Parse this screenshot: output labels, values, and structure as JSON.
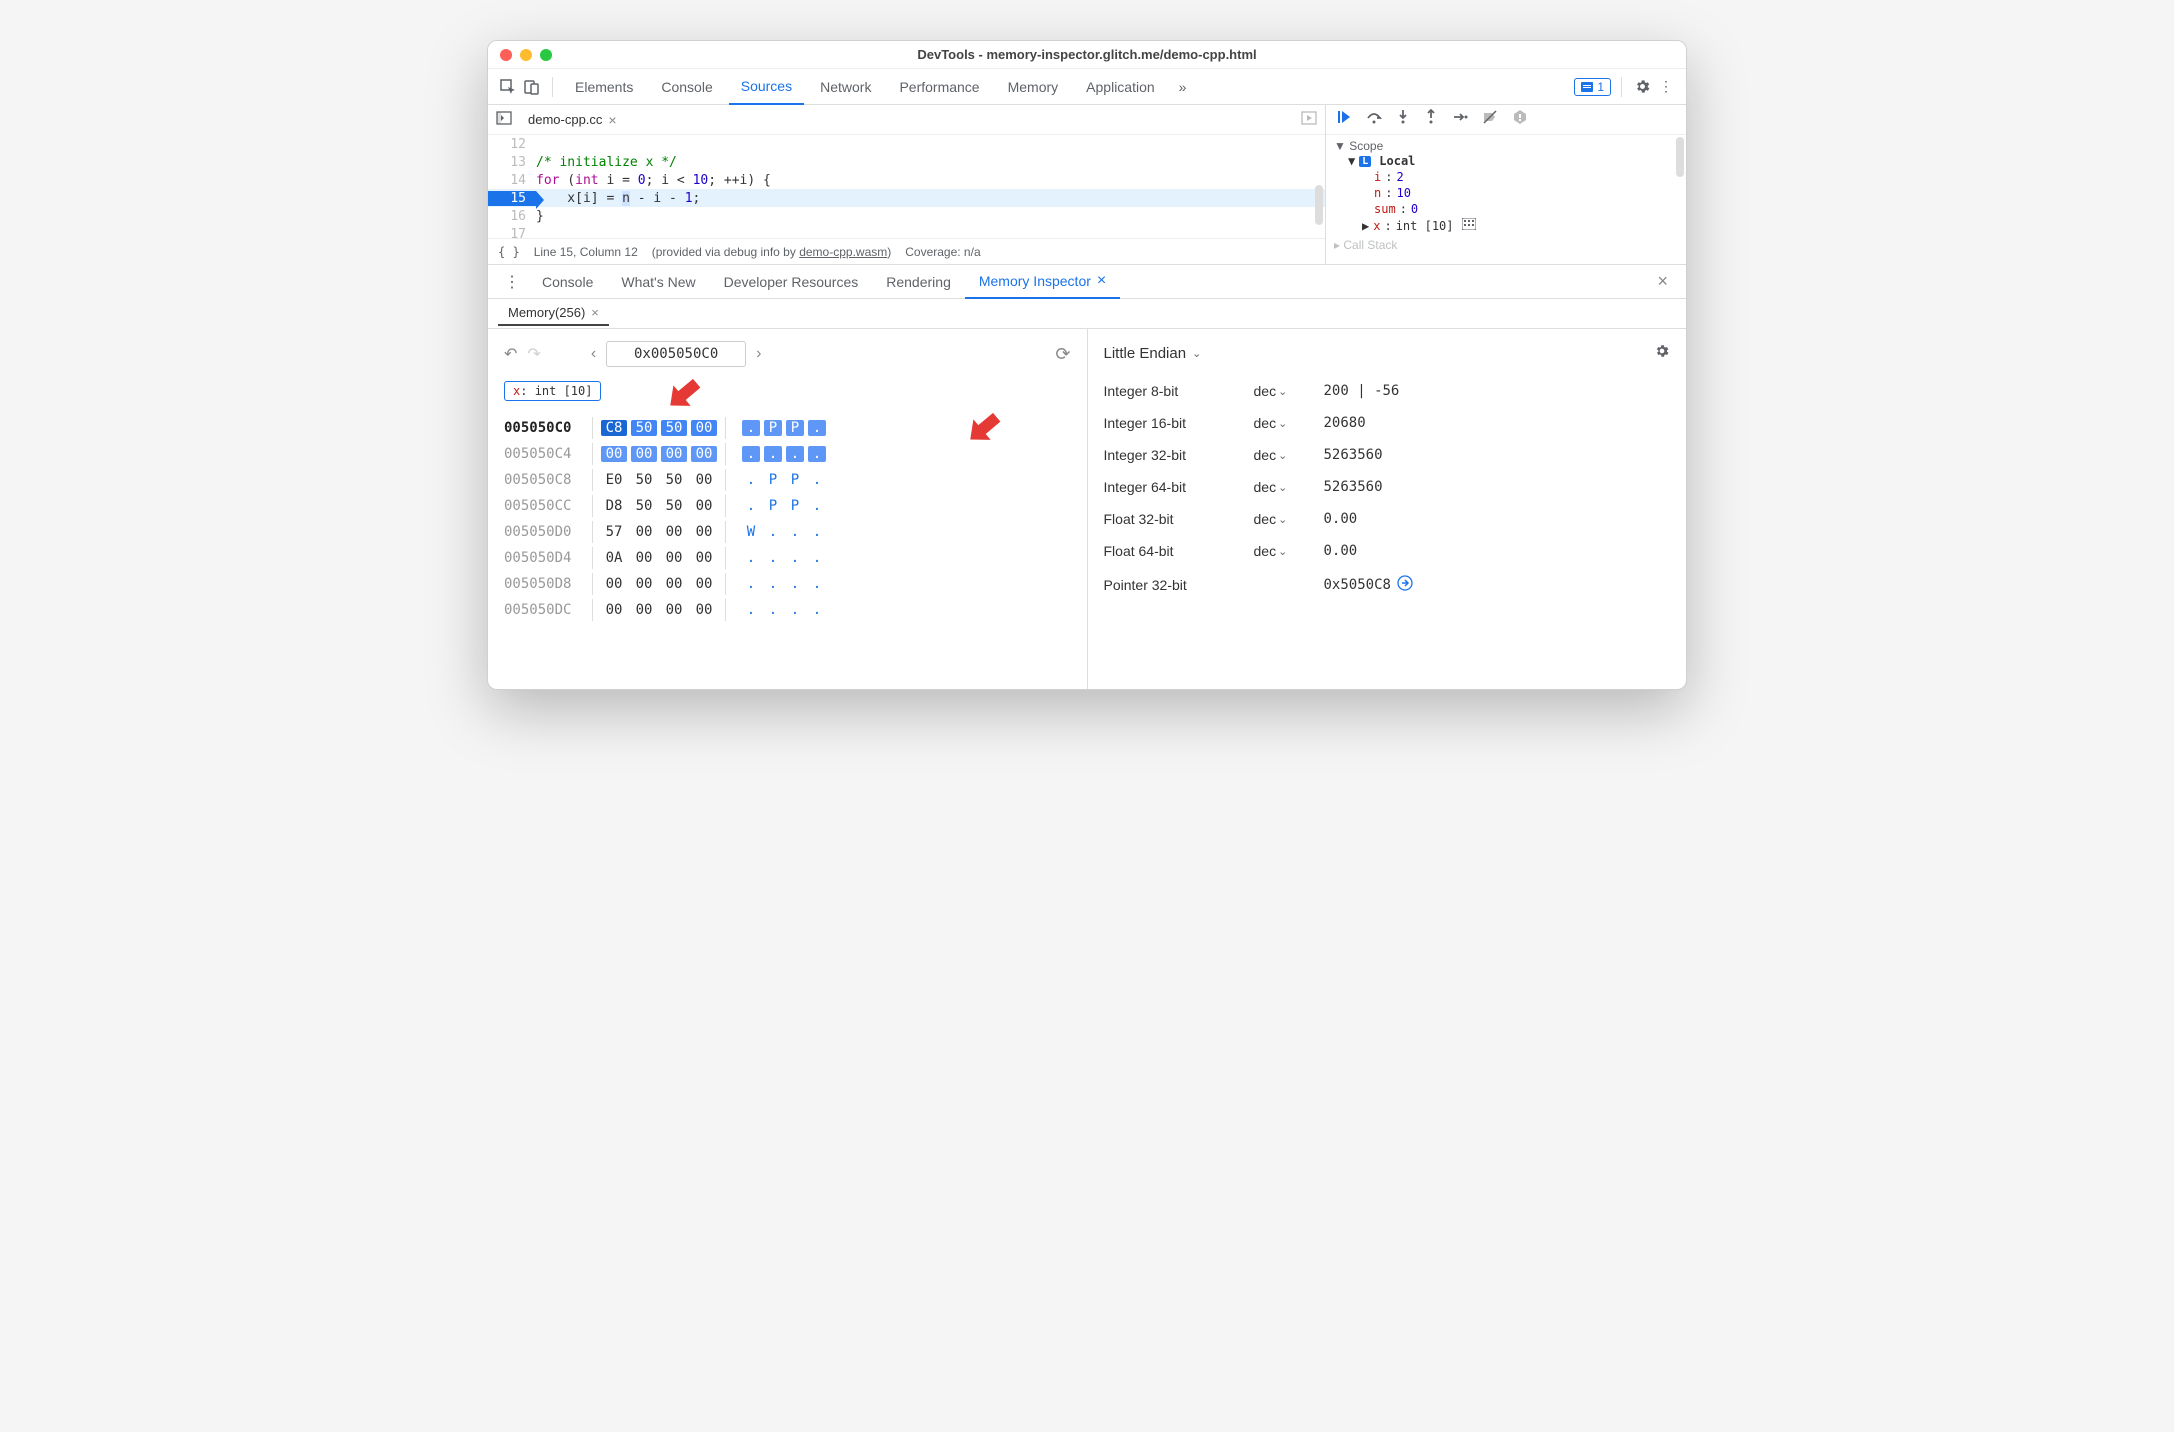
{
  "window": {
    "title": "DevTools - memory-inspector.glitch.me/demo-cpp.html"
  },
  "mainTabs": {
    "items": [
      "Elements",
      "Console",
      "Sources",
      "Network",
      "Performance",
      "Memory",
      "Application"
    ],
    "active": "Sources",
    "badgeCount": "1"
  },
  "file": {
    "name": "demo-cpp.cc"
  },
  "code": {
    "lines": [
      {
        "n": "12",
        "text": ""
      },
      {
        "n": "13",
        "text": "/* initialize x */",
        "cls": "com"
      },
      {
        "n": "14",
        "text_pre": "for (",
        "text_kw": "int",
        "text_mid": " i = 0; i < 10; ++i) {"
      },
      {
        "n": "15",
        "text": "    x[i] = n - i - 1;",
        "hl": true
      },
      {
        "n": "16",
        "text": "}"
      },
      {
        "n": "17",
        "text": ""
      }
    ]
  },
  "statusbar": {
    "cursor": "Line 15, Column 12",
    "via_prefix": "(provided via debug info by ",
    "via_link": "demo-cpp.wasm",
    "via_suffix": ")",
    "coverage": "Coverage: n/a"
  },
  "scope": {
    "header": "▼ Scope",
    "local": "Local",
    "vars": [
      {
        "name": "i",
        "value": "2"
      },
      {
        "name": "n",
        "value": "10"
      },
      {
        "name": "sum",
        "value": "0"
      },
      {
        "name": "x",
        "value": "int [10]",
        "expandable": true,
        "extra_icon": true
      }
    ],
    "callstackLabel": "Call Stack"
  },
  "drawerTabs": {
    "items": [
      "Console",
      "What's New",
      "Developer Resources",
      "Rendering",
      "Memory Inspector"
    ],
    "active": "Memory Inspector"
  },
  "memoryTab": {
    "label": "Memory(256)"
  },
  "memNav": {
    "address": "0x005050C0"
  },
  "objectTag": {
    "name": "x",
    "type": "int [10]"
  },
  "hexRows": [
    {
      "addr": "005050C0",
      "bold": true,
      "bytes": [
        "C8",
        "50",
        "50",
        "00"
      ],
      "ascii": [
        ".",
        "P",
        "P",
        "."
      ],
      "hl": 1
    },
    {
      "addr": "005050C4",
      "bytes": [
        "00",
        "00",
        "00",
        "00"
      ],
      "ascii": [
        ".",
        ".",
        ".",
        "."
      ],
      "hl": 2
    },
    {
      "addr": "005050C8",
      "bytes": [
        "E0",
        "50",
        "50",
        "00"
      ],
      "ascii": [
        ".",
        "P",
        "P",
        "."
      ]
    },
    {
      "addr": "005050CC",
      "bytes": [
        "D8",
        "50",
        "50",
        "00"
      ],
      "ascii": [
        ".",
        "P",
        "P",
        "."
      ]
    },
    {
      "addr": "005050D0",
      "bytes": [
        "57",
        "00",
        "00",
        "00"
      ],
      "ascii": [
        "W",
        ".",
        ".",
        "."
      ]
    },
    {
      "addr": "005050D4",
      "bytes": [
        "0A",
        "00",
        "00",
        "00"
      ],
      "ascii": [
        ".",
        ".",
        ".",
        "."
      ]
    },
    {
      "addr": "005050D8",
      "bytes": [
        "00",
        "00",
        "00",
        "00"
      ],
      "ascii": [
        ".",
        ".",
        ".",
        "."
      ]
    },
    {
      "addr": "005050DC",
      "bytes": [
        "00",
        "00",
        "00",
        "00"
      ],
      "ascii": [
        ".",
        ".",
        ".",
        "."
      ]
    }
  ],
  "endian": {
    "label": "Little Endian"
  },
  "interpret": [
    {
      "name": "Integer 8-bit",
      "fmt": "dec",
      "value": "200 | -56"
    },
    {
      "name": "Integer 16-bit",
      "fmt": "dec",
      "value": "20680"
    },
    {
      "name": "Integer 32-bit",
      "fmt": "dec",
      "value": "5263560"
    },
    {
      "name": "Integer 64-bit",
      "fmt": "dec",
      "value": "5263560"
    },
    {
      "name": "Float 32-bit",
      "fmt": "dec",
      "value": "0.00"
    },
    {
      "name": "Float 64-bit",
      "fmt": "dec",
      "value": "0.00"
    },
    {
      "name": "Pointer 32-bit",
      "fmt": "",
      "value": "0x5050C8",
      "jump": true
    }
  ]
}
